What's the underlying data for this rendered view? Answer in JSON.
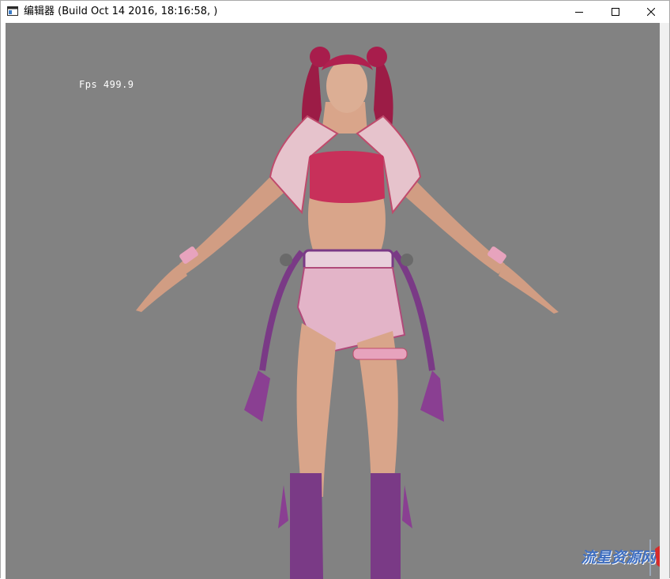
{
  "window": {
    "title": "编辑器 (Build Oct 14 2016, 18:16:58, )",
    "minimize_label": "minimize",
    "maximize_label": "maximize",
    "close_label": "close"
  },
  "viewport": {
    "background": "#828282",
    "fps_label": "Fps 499.9",
    "model": "3d-character-t-pose"
  },
  "watermark": {
    "text": "流星资源网"
  },
  "colors": {
    "hair": "#b0204f",
    "skin": "#d9a58a",
    "top": "#c8305a",
    "jacket": "#e6c3cc",
    "skirt": "#e3b4c8",
    "purple": "#7a3a86"
  }
}
